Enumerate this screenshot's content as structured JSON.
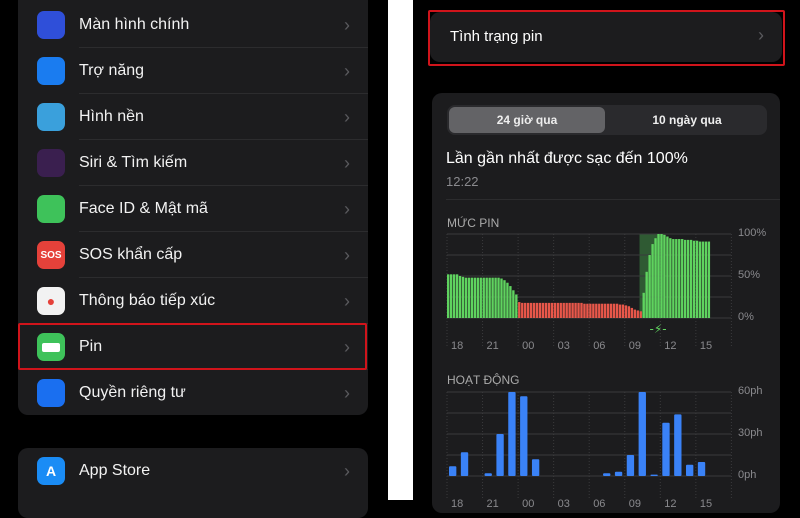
{
  "settings": {
    "items": [
      {
        "label": "Màn hình chính",
        "icon": "home-screen-icon",
        "color": "#2f4fd9"
      },
      {
        "label": "Trợ năng",
        "icon": "accessibility-icon",
        "color": "#1a7cf0"
      },
      {
        "label": "Hình nền",
        "icon": "wallpaper-icon",
        "color": "#3aa0dc"
      },
      {
        "label": "Siri & Tìm kiếm",
        "icon": "siri-icon",
        "color": "#3a1f4f"
      },
      {
        "label": "Face ID & Mật mã",
        "icon": "face-id-icon",
        "color": "#3ec25a"
      },
      {
        "label": "SOS khẩn cấp",
        "icon": "sos-icon",
        "color": "#e5413a",
        "glyph": "SOS"
      },
      {
        "label": "Thông báo tiếp xúc",
        "icon": "exposure-notification-icon",
        "color": "#f2f2f2"
      },
      {
        "label": "Pin",
        "icon": "battery-icon",
        "color": "#3ec25a"
      },
      {
        "label": "Quyền riêng tư",
        "icon": "privacy-hand-icon",
        "color": "#1a6ff0"
      }
    ],
    "app_store": {
      "label": "App Store",
      "icon": "app-store-icon",
      "color": "#1a8cf5"
    }
  },
  "battery": {
    "health_label": "Tình trạng pin",
    "tabs": [
      "24 giờ qua",
      "10 ngày qua"
    ],
    "selected_tab": "24 giờ qua",
    "last_charged_label": "Lần gần nhất được sạc đến 100%",
    "last_charged_time": "12:22"
  },
  "chart_data": [
    {
      "type": "bar",
      "title": "MỨC PIN",
      "x_tick_labels": [
        "18",
        "21",
        "00",
        "03",
        "06",
        "09",
        "12",
        "15"
      ],
      "y_tick_labels": [
        "100%",
        "50%",
        "0%"
      ],
      "ylim": [
        0,
        100
      ],
      "x_start": "18:00",
      "interval_minutes": 15,
      "values": [
        52,
        52,
        52,
        52,
        50,
        49,
        48,
        48,
        48,
        48,
        48,
        48,
        48,
        48,
        48,
        48,
        48,
        48,
        47,
        45,
        42,
        38,
        33,
        28,
        19,
        18,
        18,
        18,
        18,
        18,
        18,
        18,
        18,
        18,
        18,
        18,
        18,
        18,
        18,
        18,
        18,
        18,
        18,
        18,
        18,
        18,
        17,
        17,
        17,
        17,
        17,
        17,
        17,
        17,
        17,
        17,
        17,
        17,
        16,
        16,
        15,
        14,
        12,
        10,
        9,
        8,
        30,
        55,
        75,
        88,
        95,
        100,
        100,
        99,
        97,
        95,
        94,
        94,
        94,
        94,
        93,
        93,
        93,
        92,
        92,
        91,
        91,
        91,
        91
      ],
      "low_threshold": 20,
      "charging_period": [
        "10:30",
        "12:20"
      ],
      "colors": {
        "normal": "#5fd35f",
        "low": "#e8574a",
        "charging_bg": "#2f5a33"
      }
    },
    {
      "type": "bar",
      "title": "HOẠT ĐỘNG",
      "x_tick_labels": [
        "18",
        "21",
        "00",
        "03",
        "06",
        "09",
        "12",
        "15"
      ],
      "y_tick_labels": [
        "60ph",
        "30ph",
        "0ph"
      ],
      "ylim": [
        0,
        60
      ],
      "categories": [
        "18",
        "19",
        "20",
        "21",
        "22",
        "23",
        "00",
        "01",
        "02",
        "03",
        "04",
        "05",
        "06",
        "07",
        "08",
        "09",
        "10",
        "11",
        "12",
        "13",
        "14",
        "15"
      ],
      "values": [
        7,
        17,
        0,
        2,
        30,
        60,
        57,
        12,
        0,
        0,
        0,
        0,
        0,
        2,
        3,
        15,
        60,
        1,
        38,
        44,
        8,
        10
      ],
      "color": "#3a82f7"
    }
  ]
}
